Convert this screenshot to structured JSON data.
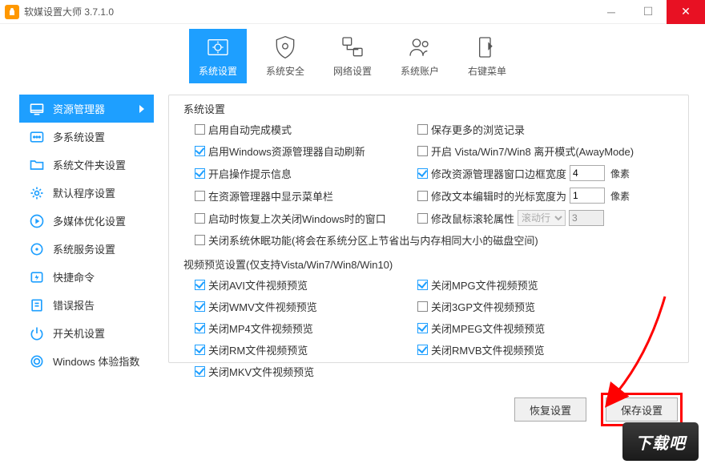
{
  "window": {
    "title": "软媒设置大师 3.7.1.0"
  },
  "topTabs": [
    {
      "label": "系统设置"
    },
    {
      "label": "系统安全"
    },
    {
      "label": "网络设置"
    },
    {
      "label": "系统账户"
    },
    {
      "label": "右键菜单"
    }
  ],
  "sidebar": [
    {
      "label": "资源管理器"
    },
    {
      "label": "多系统设置"
    },
    {
      "label": "系统文件夹设置"
    },
    {
      "label": "默认程序设置"
    },
    {
      "label": "多媒体优化设置"
    },
    {
      "label": "系统服务设置"
    },
    {
      "label": "快捷命令"
    },
    {
      "label": "错误报告"
    },
    {
      "label": "开关机设置"
    },
    {
      "label": "Windows 体验指数"
    }
  ],
  "section1": {
    "title": "系统设置",
    "left": [
      {
        "label": "启用自动完成模式",
        "checked": false
      },
      {
        "label": "启用Windows资源管理器自动刷新",
        "checked": true
      },
      {
        "label": "开启操作提示信息",
        "checked": true
      },
      {
        "label": "在资源管理器中显示菜单栏",
        "checked": false
      },
      {
        "label": "启动时恢复上次关闭Windows时的窗口",
        "checked": false
      },
      {
        "label": "关闭系统休眠功能(将会在系统分区上节省出与内存相同大小的磁盘空间)",
        "checked": false
      }
    ],
    "right": [
      {
        "label": "保存更多的浏览记录",
        "checked": false
      },
      {
        "label": "开启 Vista/Win7/Win8 离开模式(AwayMode)",
        "checked": false
      },
      {
        "label": "修改资源管理器窗口边框宽度",
        "checked": true,
        "value": "4",
        "unit": "像素"
      },
      {
        "label": "修改文本编辑时的光标宽度为",
        "checked": false,
        "value": "1",
        "unit": "像素"
      },
      {
        "label": "修改鼠标滚轮属性",
        "checked": false,
        "select": "滚动行",
        "value2": "3"
      }
    ]
  },
  "section2": {
    "title": "视频预览设置(仅支持Vista/Win7/Win8/Win10)",
    "left": [
      {
        "label": "关闭AVI文件视频预览",
        "checked": true
      },
      {
        "label": "关闭WMV文件视频预览",
        "checked": true
      },
      {
        "label": "关闭MP4文件视频预览",
        "checked": true
      },
      {
        "label": "关闭RM文件视频预览",
        "checked": true
      },
      {
        "label": "关闭MKV文件视频预览",
        "checked": true
      }
    ],
    "right": [
      {
        "label": "关闭MPG文件视频预览",
        "checked": true
      },
      {
        "label": "关闭3GP文件视频预览",
        "checked": false
      },
      {
        "label": "关闭MPEG文件视频预览",
        "checked": true
      },
      {
        "label": "关闭RMVB文件视频预览",
        "checked": true
      }
    ]
  },
  "buttons": {
    "restore": "恢复设置",
    "save": "保存设置"
  },
  "watermark": "下载吧"
}
